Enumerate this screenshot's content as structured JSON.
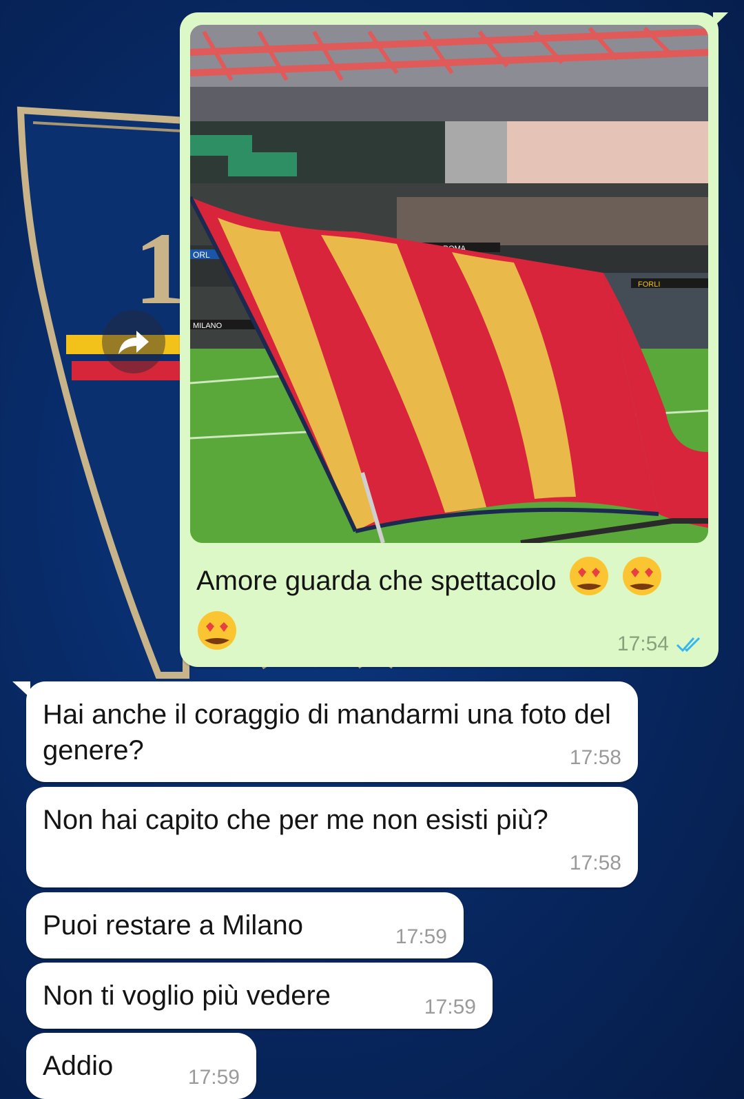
{
  "colors": {
    "outgoing_bubble": "#dcf8c6",
    "incoming_bubble": "#ffffff",
    "wallpaper": "#082a66",
    "read_ticks": "#34b7f1"
  },
  "wallpaper": {
    "crest_number": "1"
  },
  "forward": {
    "icon": "forward-arrow-icon"
  },
  "outgoing": {
    "photo_banners": [
      "ORL",
      "BOTS ROMA",
      "MILANO",
      "FORLI"
    ],
    "caption": "Amore guarda che spettacolo",
    "caption_emojis": [
      "heart-eyes-emoji",
      "heart-eyes-emoji",
      "heart-eyes-emoji"
    ],
    "time": "17:54",
    "status_icon": "double-check-read-icon"
  },
  "incoming": [
    {
      "text": "Hai anche il coraggio di mandarmi una foto del genere?",
      "time": "17:58"
    },
    {
      "text": "Non hai capito che per me non esisti più?",
      "time": "17:58"
    },
    {
      "text": "Puoi restare a Milano",
      "time": "17:59"
    },
    {
      "text": "Non ti voglio più vedere",
      "time": "17:59"
    },
    {
      "text": "Addio",
      "time": "17:59"
    }
  ]
}
